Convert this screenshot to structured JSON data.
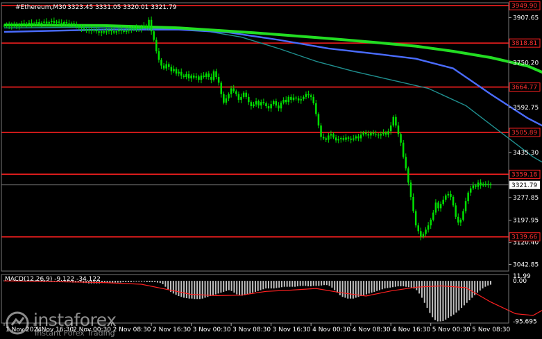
{
  "header": {
    "symbol": "#Ethereum,M30",
    "ohlc": "3323.45  3331.05  3320.01  3321.79",
    "macd_label": "MACD(12,26,9) -9.122 -34.122"
  },
  "branding": {
    "name": "instaforex",
    "tagline": "Instant Forex Trading",
    "logo_icon": "instaforex-logo-icon"
  },
  "colors": {
    "background": "#000000",
    "candle": "#00e000",
    "level": "#ff2020",
    "ma_fast": "#1f8f8f",
    "ma_mid": "#4a6cff",
    "ma_slow": "#22dd22",
    "macd_hist": "#c0c0c0",
    "macd_signal": "#ff2020",
    "grid": "#ffffff"
  },
  "chart_data": {
    "type": "candlestick",
    "instrument": "#Ethereum",
    "timeframe": "M30",
    "current_price": 3321.79,
    "current_price_label": "3321.79",
    "ylim": [
      3020,
      3960
    ],
    "price_ticks": [
      {
        "value": 3907.65,
        "label": "3907.65"
      },
      {
        "value": 3750.2,
        "label": "3750.20"
      },
      {
        "value": 3592.75,
        "label": "3592.75"
      },
      {
        "value": 3435.3,
        "label": "3435.30"
      },
      {
        "value": 3277.85,
        "label": "3277.85"
      },
      {
        "value": 3197.95,
        "label": "3197.95"
      },
      {
        "value": 3120.4,
        "label": "3120.40"
      },
      {
        "value": 3042.85,
        "label": "3042.85"
      }
    ],
    "levels": [
      {
        "value": 3949.9,
        "label": "3949.90"
      },
      {
        "value": 3818.81,
        "label": "3818.81"
      },
      {
        "value": 3664.77,
        "label": "3664.77"
      },
      {
        "value": 3505.89,
        "label": "3505.89"
      },
      {
        "value": 3359.18,
        "label": "3359.18"
      },
      {
        "value": 3139.66,
        "label": "3139.66"
      }
    ],
    "time_labels": [
      {
        "label": "1 Nov 2024",
        "index": 0
      },
      {
        "label": "1 Nov 16:30",
        "index": 12
      },
      {
        "label": "2 Nov 00:30",
        "index": 27
      },
      {
        "label": "2 Nov 08:30",
        "index": 43
      },
      {
        "label": "2 Nov 16:30",
        "index": 59
      },
      {
        "label": "3 Nov 00:30",
        "index": 75
      },
      {
        "label": "3 Nov 08:30",
        "index": 91
      },
      {
        "label": "3 Nov 16:30",
        "index": 107
      },
      {
        "label": "4 Nov 00:30",
        "index": 123
      },
      {
        "label": "4 Nov 08:30",
        "index": 139
      },
      {
        "label": "4 Nov 16:30",
        "index": 155
      },
      {
        "label": "5 Nov 00:30",
        "index": 171
      },
      {
        "label": "5 Nov 08:30",
        "index": 187
      }
    ],
    "closes": [
      3880,
      3882,
      3878,
      3885,
      3880,
      3876,
      3884,
      3888,
      3882,
      3886,
      3890,
      3884,
      3888,
      3892,
      3886,
      3890,
      3894,
      3888,
      3892,
      3896,
      3890,
      3894,
      3890,
      3886,
      3892,
      3888,
      3884,
      3888,
      3882,
      3878,
      3874,
      3870,
      3866,
      3862,
      3866,
      3862,
      3866,
      3860,
      3855,
      3860,
      3856,
      3860,
      3865,
      3860,
      3856,
      3860,
      3866,
      3862,
      3858,
      3862,
      3866,
      3870,
      3866,
      3872,
      3868,
      3874,
      3880,
      3872,
      3900,
      3860,
      3830,
      3790,
      3760,
      3740,
      3730,
      3745,
      3735,
      3720,
      3728,
      3712,
      3718,
      3705,
      3700,
      3710,
      3695,
      3705,
      3698,
      3702,
      3690,
      3705,
      3700,
      3712,
      3700,
      3690,
      3720,
      3700,
      3680,
      3640,
      3610,
      3625,
      3640,
      3660,
      3650,
      3640,
      3620,
      3630,
      3645,
      3630,
      3612,
      3598,
      3604,
      3615,
      3600,
      3612,
      3608,
      3598,
      3590,
      3605,
      3615,
      3600,
      3590,
      3610,
      3620,
      3612,
      3630,
      3620,
      3628,
      3625,
      3618,
      3622,
      3630,
      3640,
      3636,
      3630,
      3608,
      3570,
      3530,
      3490,
      3485,
      3480,
      3495,
      3500,
      3488,
      3478,
      3482,
      3486,
      3480,
      3488,
      3484,
      3480,
      3485,
      3492,
      3485,
      3498,
      3505,
      3500,
      3495,
      3505,
      3500,
      3498,
      3495,
      3500,
      3505,
      3498,
      3510,
      3530,
      3560,
      3530,
      3500,
      3470,
      3420,
      3380,
      3330,
      3280,
      3230,
      3180,
      3160,
      3140,
      3150,
      3165,
      3180,
      3200,
      3225,
      3260,
      3240,
      3255,
      3270,
      3285,
      3290,
      3280,
      3250,
      3210,
      3190,
      3200,
      3230,
      3265,
      3295,
      3310,
      3320,
      3315,
      3330,
      3320,
      3326,
      3322,
      3325,
      3321.79
    ],
    "ma_slow_points": [
      [
        0,
        3882
      ],
      [
        40,
        3880
      ],
      [
        70,
        3872
      ],
      [
        100,
        3855
      ],
      [
        130,
        3835
      ],
      [
        150,
        3820
      ],
      [
        165,
        3808
      ],
      [
        180,
        3790
      ],
      [
        195,
        3768
      ],
      [
        210,
        3738
      ],
      [
        220,
        3700
      ]
    ],
    "ma_mid_points": [
      [
        0,
        3858
      ],
      [
        40,
        3866
      ],
      [
        70,
        3866
      ],
      [
        90,
        3856
      ],
      [
        110,
        3830
      ],
      [
        130,
        3800
      ],
      [
        150,
        3780
      ],
      [
        165,
        3764
      ],
      [
        180,
        3730
      ],
      [
        195,
        3640
      ],
      [
        210,
        3555
      ],
      [
        220,
        3510
      ]
    ],
    "ma_fast_points": [
      [
        0,
        3872
      ],
      [
        30,
        3874
      ],
      [
        60,
        3870
      ],
      [
        80,
        3862
      ],
      [
        95,
        3840
      ],
      [
        110,
        3800
      ],
      [
        125,
        3755
      ],
      [
        140,
        3720
      ],
      [
        155,
        3690
      ],
      [
        170,
        3660
      ],
      [
        185,
        3600
      ],
      [
        200,
        3500
      ],
      [
        212,
        3420
      ],
      [
        220,
        3380
      ]
    ],
    "macd": {
      "label": "MACD(12,26,9)",
      "main": -9.122,
      "signal": -34.122,
      "ylim": [
        -100,
        15
      ],
      "ticks": [
        {
          "value": 11.99,
          "label": "11.99"
        },
        {
          "value": 0,
          "label": "0.00"
        },
        {
          "value": -95.695,
          "label": "-95.695"
        }
      ],
      "hist": [
        1,
        1,
        1,
        1,
        2,
        2,
        2,
        1,
        1,
        1,
        1,
        1,
        1,
        1,
        1,
        1,
        0,
        0,
        0,
        -1,
        -1,
        -2,
        -2,
        -3,
        -3,
        -3,
        -4,
        -4,
        -4,
        -4,
        -5,
        -5,
        -6,
        -6,
        -6,
        -6,
        -6,
        -5,
        -5,
        -5,
        -5,
        -4,
        -4,
        -4,
        -4,
        -3,
        -3,
        -3,
        -3,
        -2,
        -2,
        -2,
        -2,
        -2,
        -3,
        -3,
        -3,
        -3,
        -4,
        -5,
        -8,
        -14,
        -20,
        -26,
        -30,
        -33,
        -36,
        -38,
        -40,
        -41,
        -42,
        -42,
        -43,
        -43,
        -43,
        -42,
        -40,
        -38,
        -36,
        -34,
        -32,
        -30,
        -28,
        -26,
        -24,
        -22,
        -24,
        -28,
        -32,
        -34,
        -35,
        -34,
        -32,
        -30,
        -28,
        -26,
        -24,
        -22,
        -20,
        -18,
        -18,
        -18,
        -18,
        -17,
        -16,
        -15,
        -14,
        -14,
        -14,
        -14,
        -14,
        -13,
        -12,
        -12,
        -12,
        -13,
        -13,
        -12,
        -12,
        -12,
        -11,
        -10,
        -10,
        -12,
        -16,
        -22,
        -28,
        -34,
        -38,
        -40,
        -42,
        -42,
        -42,
        -40,
        -38,
        -36,
        -34,
        -32,
        -30,
        -28,
        -26,
        -24,
        -22,
        -20,
        -18,
        -17,
        -16,
        -15,
        -14,
        -13,
        -13,
        -13,
        -14,
        -15,
        -16,
        -18,
        -22,
        -30,
        -40,
        -52,
        -64,
        -76,
        -86,
        -93,
        -96,
        -96,
        -95,
        -92,
        -88,
        -84,
        -80,
        -75,
        -70,
        -64,
        -58,
        -52,
        -46,
        -40,
        -34,
        -28,
        -23,
        -18,
        -14,
        -11,
        -9
      ],
      "signal_points": [
        [
          0,
          0
        ],
        [
          20,
          -2
        ],
        [
          40,
          -4
        ],
        [
          55,
          -8
        ],
        [
          65,
          -20
        ],
        [
          75,
          -32
        ],
        [
          85,
          -35
        ],
        [
          95,
          -34
        ],
        [
          105,
          -25
        ],
        [
          115,
          -22
        ],
        [
          125,
          -18
        ],
        [
          135,
          -28
        ],
        [
          145,
          -36
        ],
        [
          155,
          -24
        ],
        [
          165,
          -15
        ],
        [
          175,
          -12
        ],
        [
          185,
          -16
        ],
        [
          195,
          -50
        ],
        [
          205,
          -78
        ],
        [
          212,
          -82
        ],
        [
          218,
          -62
        ],
        [
          224,
          -38
        ]
      ]
    }
  }
}
